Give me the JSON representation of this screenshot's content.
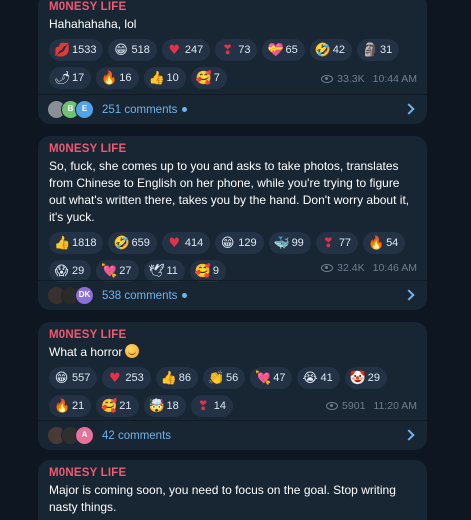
{
  "posts": [
    {
      "author": "M0NESY LIFE",
      "text": "Hahahahaha, lol",
      "reactions": [
        {
          "icon": "kiss-mark-icon",
          "glyph": "💋",
          "count": "1533"
        },
        {
          "icon": "smiling-face-icon",
          "glyph": "😁",
          "count": "518"
        },
        {
          "icon": "red-heart-icon",
          "glyph": "♥",
          "count": "247"
        },
        {
          "icon": "heart-exclamation-icon",
          "glyph": "❣",
          "count": "73"
        },
        {
          "icon": "heart-ribbon-icon",
          "glyph": "💝",
          "count": "65"
        },
        {
          "icon": "rofl-face-icon",
          "glyph": "🤣",
          "count": "42"
        },
        {
          "icon": "moai-icon",
          "glyph": "🗿",
          "count": "31"
        },
        {
          "icon": "hot-pepper-icon",
          "glyph": "🌶",
          "count": "17"
        },
        {
          "icon": "fire-icon",
          "glyph": "🔥",
          "count": "16"
        },
        {
          "icon": "thumbs-up-icon",
          "glyph": "👍",
          "count": "10"
        },
        {
          "icon": "smiling-hearts-face-icon",
          "glyph": "🥰",
          "count": "7"
        }
      ],
      "views": "33.3K",
      "time": "10:44 AM",
      "comments": "251 comments",
      "comment_dot": true,
      "avatars": [
        {
          "label": "",
          "color": "#8a8f96"
        },
        {
          "label": "B",
          "color": "#6fc174"
        },
        {
          "label": "E",
          "color": "#4fa3e6"
        }
      ]
    },
    {
      "author": "M0NESY LIFE",
      "text": "So, fuck, she comes up to you and asks to take photos, translates from Chinese to English on her phone, while you're trying to figure out what's written there, takes you by the hand. Don't worry about it, it's yuck.",
      "reactions": [
        {
          "icon": "thumbs-up-icon",
          "glyph": "👍",
          "count": "1818"
        },
        {
          "icon": "rofl-face-icon",
          "glyph": "🤣",
          "count": "659"
        },
        {
          "icon": "red-heart-icon",
          "glyph": "♥",
          "count": "414"
        },
        {
          "icon": "grinning-face-icon",
          "glyph": "😁",
          "count": "129"
        },
        {
          "icon": "whale-icon",
          "glyph": "🐳",
          "count": "99"
        },
        {
          "icon": "heart-exclamation-icon",
          "glyph": "❣",
          "count": "77"
        },
        {
          "icon": "fire-icon",
          "glyph": "🔥",
          "count": "54"
        },
        {
          "icon": "screaming-face-icon",
          "glyph": "😱",
          "count": "29"
        },
        {
          "icon": "heart-ribbon-icon",
          "glyph": "💘",
          "count": "27"
        },
        {
          "icon": "dove-icon",
          "glyph": "🕊",
          "count": "11"
        },
        {
          "icon": "smiling-hearts-face-icon",
          "glyph": "🥰",
          "count": "9"
        }
      ],
      "views": "32.4K",
      "time": "10:46 AM",
      "comments": "538 comments",
      "comment_dot": true,
      "avatars": [
        {
          "label": "",
          "color": "#3a3030"
        },
        {
          "label": "",
          "color": "#2a2a2a"
        },
        {
          "label": "DK",
          "color": "#8b6fd6"
        }
      ]
    },
    {
      "author": "M0NESY LIFE",
      "text": "What a horror",
      "reactions": [
        {
          "icon": "grinning-face-icon",
          "glyph": "😁",
          "count": "557"
        },
        {
          "icon": "red-heart-icon",
          "glyph": "♥",
          "count": "253"
        },
        {
          "icon": "thumbs-up-icon",
          "glyph": "👍",
          "count": "86"
        },
        {
          "icon": "clapping-hands-icon",
          "glyph": "👏",
          "count": "56"
        },
        {
          "icon": "heart-ribbon-icon",
          "glyph": "💘",
          "count": "47"
        },
        {
          "icon": "crying-face-icon",
          "glyph": "😭",
          "count": "41"
        },
        {
          "icon": "clown-face-icon",
          "glyph": "🤡",
          "count": "29"
        },
        {
          "icon": "fire-icon",
          "glyph": "🔥",
          "count": "21"
        },
        {
          "icon": "smiling-hearts-face-icon",
          "glyph": "🥰",
          "count": "21"
        },
        {
          "icon": "exploding-head-icon",
          "glyph": "🤯",
          "count": "18"
        },
        {
          "icon": "heart-exclamation-icon",
          "glyph": "❣",
          "count": "14"
        }
      ],
      "views": "5901",
      "time": "11:20 AM",
      "comments": "42 comments",
      "comment_dot": false,
      "avatars": [
        {
          "label": "",
          "color": "#4a3a36"
        },
        {
          "label": "",
          "color": "#2f2f2f"
        },
        {
          "label": "A",
          "color": "#e8719a"
        }
      ]
    },
    {
      "author": "M0NESY LIFE",
      "text": "Major is coming soon, you need to focus on the goal. Stop writing nasty things."
    }
  ],
  "colors": {
    "background": "#0e1621",
    "bubble": "#182533",
    "author": "#ee5a73",
    "link": "#6fb2ec",
    "meta": "#6d7f8f"
  }
}
